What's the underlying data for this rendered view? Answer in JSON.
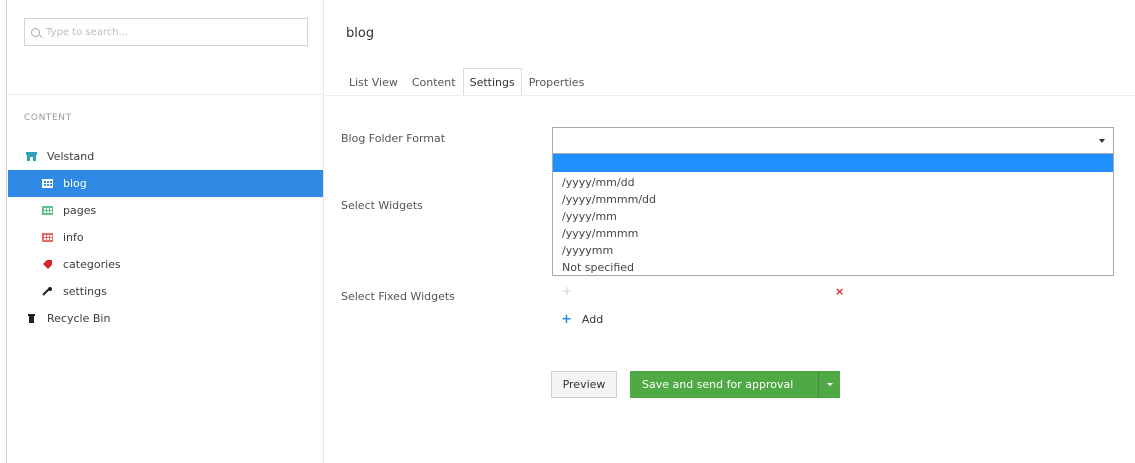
{
  "search": {
    "placeholder": "Type to search..."
  },
  "tree": {
    "section_title": "CONTENT",
    "items": [
      {
        "label": "Velstand",
        "icon": "site-icon",
        "color": "#2fa0b5",
        "level": "root",
        "selected": false
      },
      {
        "label": "blog",
        "icon": "folder-grid-icon",
        "color": "#ffffff",
        "level": "child",
        "selected": true
      },
      {
        "label": "pages",
        "icon": "folder-grid-icon",
        "color": "#62c08a",
        "level": "child",
        "selected": false
      },
      {
        "label": "info",
        "icon": "folder-grid-icon",
        "color": "#e66a6a",
        "level": "child",
        "selected": false
      },
      {
        "label": "categories",
        "icon": "tag-icon",
        "color": "#d9232a",
        "level": "child",
        "selected": false
      },
      {
        "label": "settings",
        "icon": "wrench-icon",
        "color": "#222222",
        "level": "child",
        "selected": false
      },
      {
        "label": "Recycle Bin",
        "icon": "trash-icon",
        "color": "#222222",
        "level": "root",
        "selected": false
      }
    ]
  },
  "node": {
    "name": "blog"
  },
  "tabs": [
    {
      "label": "List View",
      "active": false
    },
    {
      "label": "Content",
      "active": false
    },
    {
      "label": "Settings",
      "active": true
    },
    {
      "label": "Properties",
      "active": false
    }
  ],
  "form": {
    "folder_format_label": "Blog Folder Format",
    "widgets_label": "Select Widgets",
    "fixed_widgets_label": "Select Fixed Widgets",
    "folder_format_value": "",
    "folder_format_options": [
      "",
      "/yyyy/mm/dd",
      "/yyyy/mmmm/dd",
      "/yyyy/mm",
      "/yyyy/mmmm",
      "/yyyymm",
      "Not specified"
    ],
    "add_label": "Add"
  },
  "actions": {
    "preview_label": "Preview",
    "save_label": "Save and send for approval"
  },
  "colors": {
    "accent": "#2f8ae5",
    "success": "#4fa944",
    "danger": "#d9232a"
  }
}
